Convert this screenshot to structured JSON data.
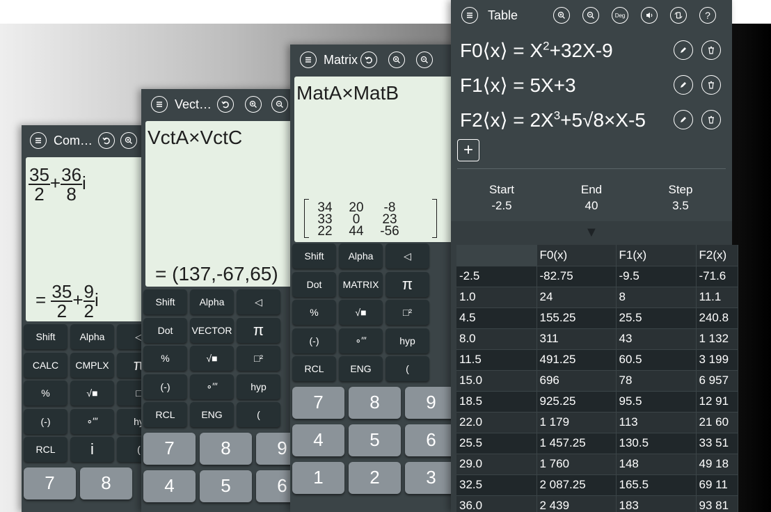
{
  "complex": {
    "title": "Com…",
    "input": {
      "re_num": "35",
      "re_den": "2",
      "im_num": "36",
      "im_den": "8",
      "i": "i",
      "plus": "+"
    },
    "result": {
      "eq": "=",
      "re_num": "35",
      "re_den": "2",
      "im_num": "9",
      "im_den": "2",
      "i": "i",
      "plus": "+"
    },
    "keys": [
      "Shift",
      "Alpha",
      "◁",
      "CALC",
      "CMPLX",
      "π",
      "%",
      "√■",
      "□",
      "(-)",
      "∘′″",
      "hy",
      "RCL",
      "i",
      "("
    ],
    "nums": [
      "7",
      "8"
    ]
  },
  "vector": {
    "title": "Vect…",
    "expression": "VctA×VctC",
    "result": "= (137,-67,65)",
    "keys": [
      "Shift",
      "Alpha",
      "◁",
      "Dot",
      "VECTOR",
      "π",
      "%",
      "√■",
      "□²",
      "(-)",
      "∘′″",
      "hyp",
      "RCL",
      "ENG",
      "("
    ],
    "nums": [
      "7",
      "8",
      "9",
      "4",
      "5",
      "6"
    ]
  },
  "matrix": {
    "title": "Matrix",
    "expression": "MatA×MatB",
    "result_matrix": [
      "34",
      "20",
      "-8",
      "33",
      "0",
      "23",
      "22",
      "44",
      "-56"
    ],
    "keys": [
      "Shift",
      "Alpha",
      "◁",
      "Dot",
      "MATRIX",
      "π",
      "%",
      "√■",
      "□²",
      "(-)",
      "∘′″",
      "hyp",
      "RCL",
      "ENG",
      "("
    ],
    "nums": [
      "7",
      "8",
      "9",
      "4",
      "5",
      "6",
      "1",
      "2",
      "3"
    ]
  },
  "table": {
    "title": "Table",
    "top_icons": [
      "zoom-in",
      "zoom-out",
      "Deg",
      "sound",
      "rotate",
      "?"
    ],
    "functions": [
      {
        "label": "F0⟨x⟩ = ",
        "expr_a": "X",
        "sup_a": "2",
        "expr_b": "+32X-9"
      },
      {
        "label": "F1⟨x⟩ = ",
        "expr_a": "5X+3",
        "sup_a": "",
        "expr_b": ""
      },
      {
        "label": "F2⟨x⟩ = ",
        "expr_a": "2X",
        "sup_a": "3",
        "expr_b": "+5√8×X-5"
      }
    ],
    "add_label": "+",
    "range": {
      "start_label": "Start",
      "start_value": "-2.5",
      "end_label": "End",
      "end_value": "40",
      "step_label": "Step",
      "step_value": "3.5"
    },
    "collapse_arrow": "▼",
    "columns": [
      "",
      "F0(x)",
      "F1(x)",
      "F2(x)"
    ],
    "rows": [
      [
        "-2.5",
        "-82.75",
        "-9.5",
        "-71.6"
      ],
      [
        "1.0",
        "24",
        "8",
        "11.1"
      ],
      [
        "4.5",
        "155.25",
        "25.5",
        "240.8"
      ],
      [
        "8.0",
        "311",
        "43",
        "1 132"
      ],
      [
        "11.5",
        "491.25",
        "60.5",
        "3 199"
      ],
      [
        "15.0",
        "696",
        "78",
        "6 957"
      ],
      [
        "18.5",
        "925.25",
        "95.5",
        "12 91"
      ],
      [
        "22.0",
        "1 179",
        "113",
        "21 60"
      ],
      [
        "25.5",
        "1 457.25",
        "130.5",
        "33 51"
      ],
      [
        "29.0",
        "1 760",
        "148",
        "49 18"
      ],
      [
        "32.5",
        "2 087.25",
        "165.5",
        "69 11"
      ],
      [
        "36.0",
        "2 439",
        "183",
        "93 81"
      ]
    ]
  }
}
